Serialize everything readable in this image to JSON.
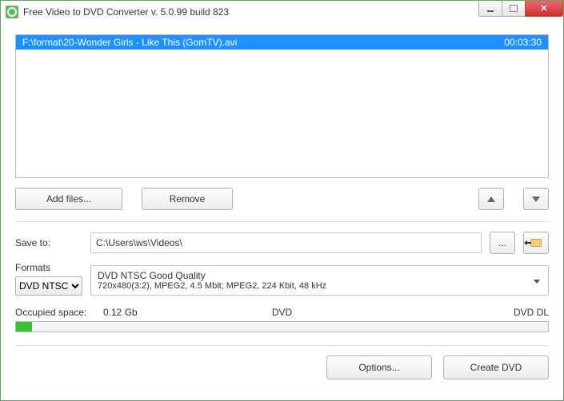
{
  "window": {
    "title": "Free Video to DVD Converter  v. 5.0.99 build 823"
  },
  "fileList": {
    "items": [
      {
        "path": "F:\\format\\20-Wonder Girls - Like This (GomTV).avi",
        "duration": "00:03:30"
      }
    ]
  },
  "buttons": {
    "addFiles": "Add files...",
    "remove": "Remove",
    "browse": "...",
    "options": "Options...",
    "createDvd": "Create DVD"
  },
  "labels": {
    "saveTo": "Save to:",
    "formats": "Formats",
    "occupied": "Occupied space:",
    "dvd": "DVD",
    "dvdDl": "DVD DL"
  },
  "saveTo": {
    "value": "C:\\Users\\ws\\Videos\\"
  },
  "formats": {
    "selected": "DVD NTSC",
    "detailLine1": "DVD NTSC Good Quality",
    "detailLine2": "720x480(3:2), MPEG2, 4.5 Mbit; MPEG2, 224 Kbit, 48 kHz"
  },
  "occupied": {
    "value": "0.12 Gb"
  }
}
